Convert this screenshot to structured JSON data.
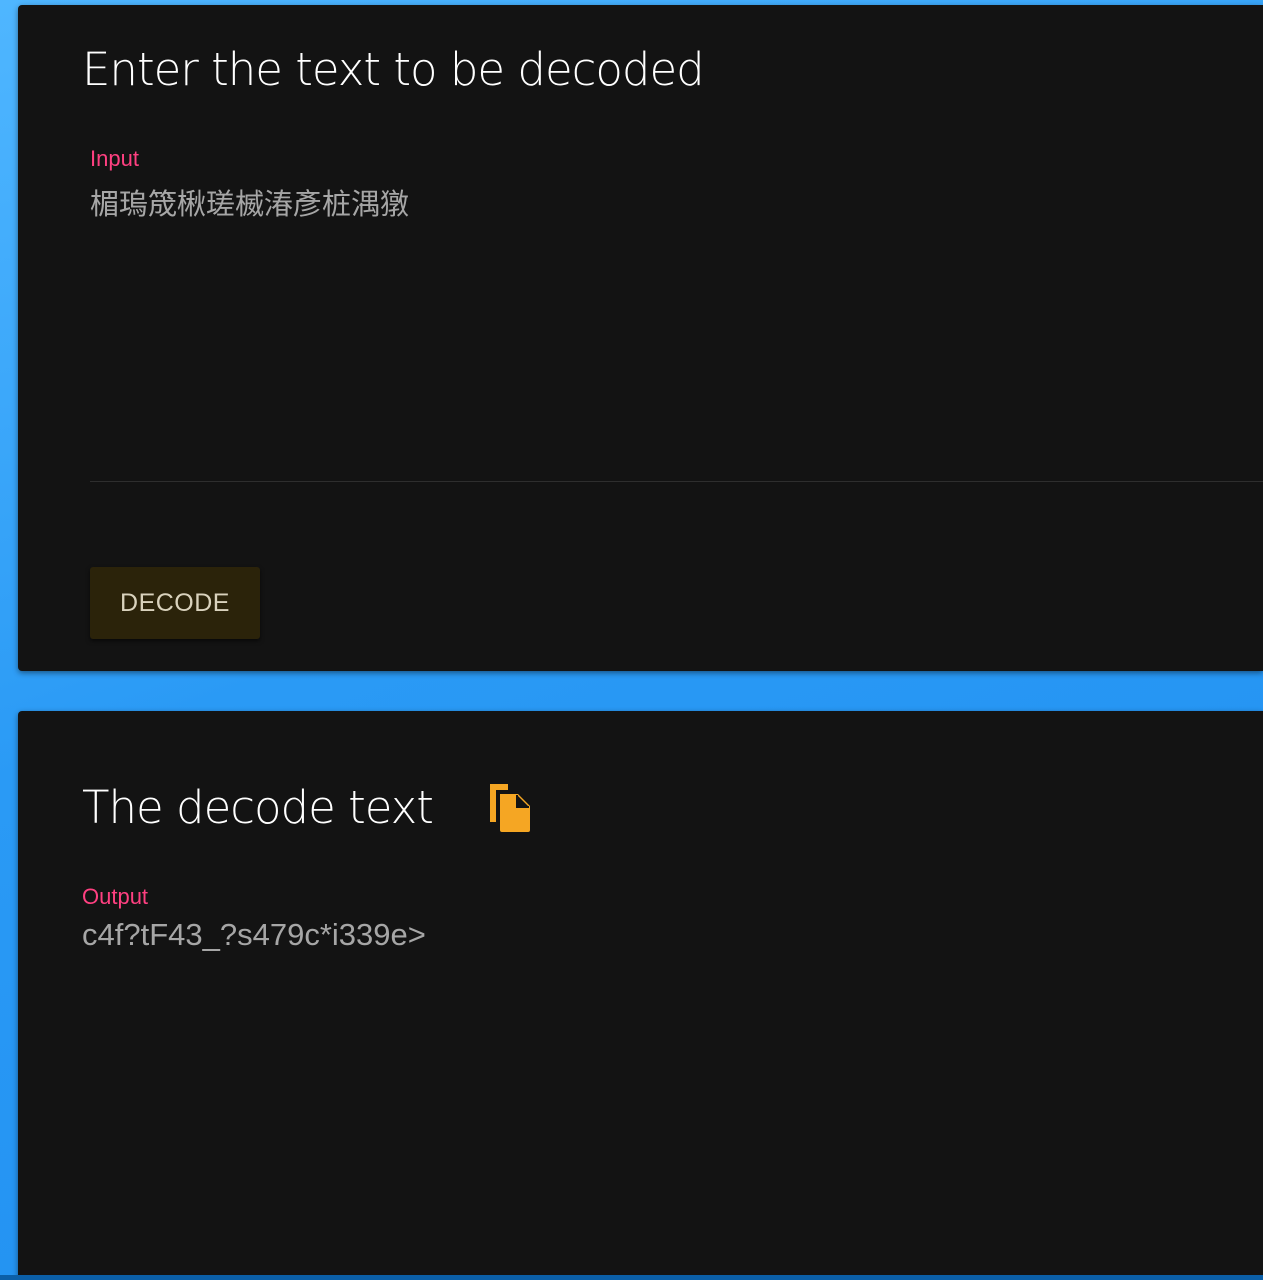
{
  "input_card": {
    "title": "Enter the text to be decoded",
    "input_label": "Input",
    "input_value": "楣瑦筬楸瑳楲湷彥桩湡獤",
    "decode_button_label": "DECODE"
  },
  "output_card": {
    "title": "The decode text",
    "copy_icon": "copy-file-icon",
    "output_label": "Output",
    "output_value": "c4f?tF43_?s479c*i339e>"
  },
  "colors": {
    "background": "#2a9af5",
    "card": "#131313",
    "label_accent": "#ff4081",
    "icon_accent": "#f5a623",
    "button_bg": "#2b230a"
  }
}
